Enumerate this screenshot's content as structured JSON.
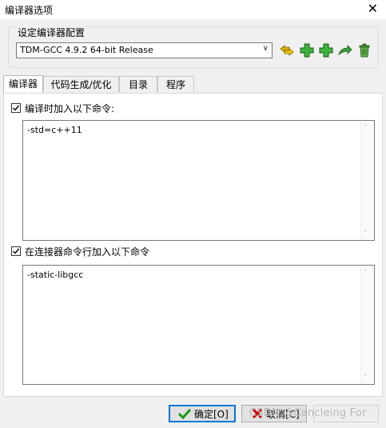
{
  "window": {
    "title": "编译器选项"
  },
  "compiler_set": {
    "group_label": "设定编译器配置",
    "selected": "TDM-GCC 4.9.2 64-bit Release",
    "buttons": [
      {
        "name": "rename-set-icon",
        "color": "#c8a000"
      },
      {
        "name": "add-set-icon",
        "color": "#2ea02e"
      },
      {
        "name": "add-set-from-folder-icon",
        "color": "#2ea02e"
      },
      {
        "name": "find-sets-icon",
        "color": "#2e8b2e"
      },
      {
        "name": "delete-set-icon",
        "color": "#4a9a3a"
      }
    ]
  },
  "tabs": [
    {
      "label": "编译器",
      "active": true
    },
    {
      "label": "代码生成/优化",
      "active": false
    },
    {
      "label": "目录",
      "active": false
    },
    {
      "label": "程序",
      "active": false
    }
  ],
  "compiler_panel": {
    "compile_cmd_checkbox": {
      "label": "编译时加入以下命令:",
      "checked": true
    },
    "compile_cmd_text": "-std=c++11",
    "linker_cmd_checkbox": {
      "label": "在连接器命令行加入以下命令",
      "checked": true
    },
    "linker_cmd_text": "-static-libgcc"
  },
  "footer": {
    "ok_label": "确定[O]",
    "cancel_label": "取消[C]",
    "watermark": "CSDN @Cancleing For"
  },
  "colors": {
    "accent": "#0078d7",
    "check_green": "#1a9a1a",
    "cancel_red": "#cc0000"
  }
}
